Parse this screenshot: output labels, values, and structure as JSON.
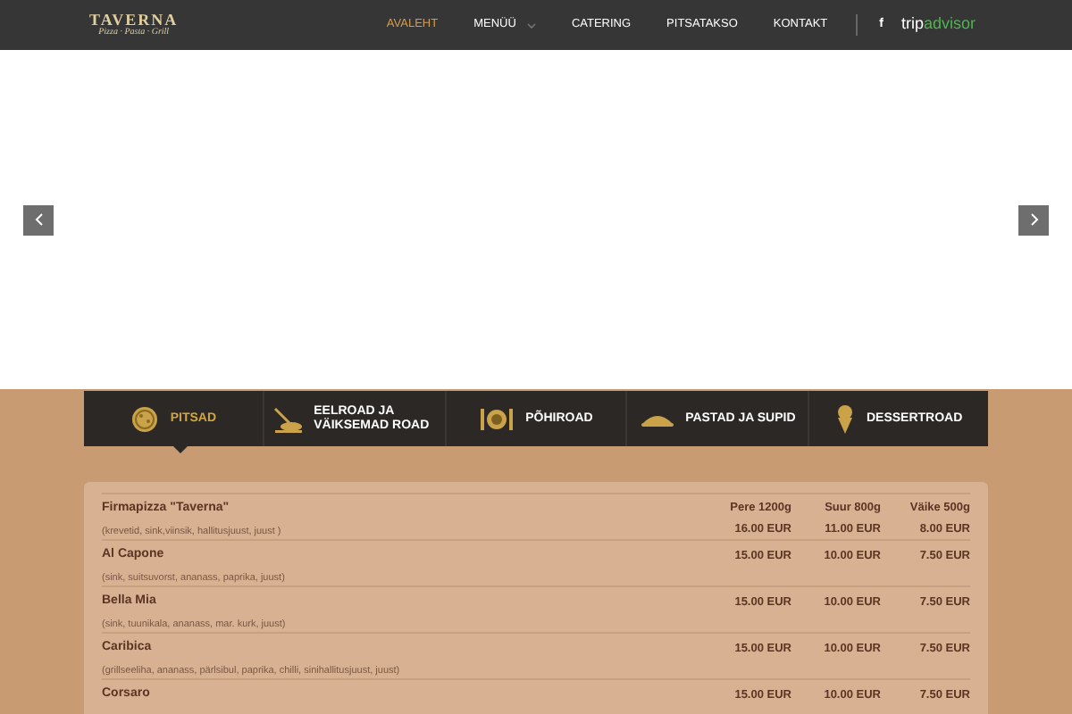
{
  "header": {
    "logo_title": "TAVERNA",
    "logo_subtitle": "Pizza · Pasta · Grill",
    "nav": [
      {
        "label": "AVALEHT",
        "selected": true,
        "dropdown": false
      },
      {
        "label": "MENÜÜ",
        "selected": false,
        "dropdown": true
      },
      {
        "label": "CATERING",
        "selected": false,
        "dropdown": false
      },
      {
        "label": "PITSATAKSO",
        "selected": false,
        "dropdown": false
      },
      {
        "label": "KONTAKT",
        "selected": false,
        "dropdown": false
      }
    ],
    "facebook": "f",
    "tripadvisor_a": "trip",
    "tripadvisor_b": "advisor"
  },
  "menu_tabs": [
    {
      "label": "PITSAD",
      "selected": true,
      "kind": "pizza"
    },
    {
      "label": "EELROAD JA VÄIKSEMAD ROAD",
      "selected": false,
      "kind": "board"
    },
    {
      "label": "PÕHIROAD",
      "selected": false,
      "kind": "plate"
    },
    {
      "label": "PASTAD JA SUPID",
      "selected": false,
      "kind": "dish"
    },
    {
      "label": "DESSERTROAD",
      "selected": false,
      "kind": "cone"
    }
  ],
  "table": {
    "columns": [
      "Pere 1200g",
      "Suur 800g",
      "Väike 500g"
    ],
    "rows": [
      {
        "name": "Firmapizza \"Taverna\"",
        "description": "(krevetid, sink,viinsik, hallitusjuust, juust )",
        "prices": [
          "16.00 EUR",
          "11.00 EUR",
          "8.00 EUR"
        ]
      },
      {
        "name": "Al Capone",
        "description": "(sink, suitsuvorst, ananass, paprika, juust)",
        "prices": [
          "15.00 EUR",
          "10.00 EUR",
          "7.50 EUR"
        ]
      },
      {
        "name": "Bella Mia",
        "description": "(sink, tuunikala, ananass, mar. kurk, juust)",
        "prices": [
          "15.00 EUR",
          "10.00 EUR",
          "7.50 EUR"
        ]
      },
      {
        "name": "Caribica",
        "description": "(grillseeliha, ananass, pärlsibul, paprika, chilli, sinihallitusjuust, juust)",
        "prices": [
          "15.00 EUR",
          "10.00 EUR",
          "7.50 EUR"
        ]
      },
      {
        "name": "Corsaro",
        "prices": [
          "15.00 EUR",
          "10.00 EUR",
          "7.50 EUR"
        ]
      }
    ]
  }
}
